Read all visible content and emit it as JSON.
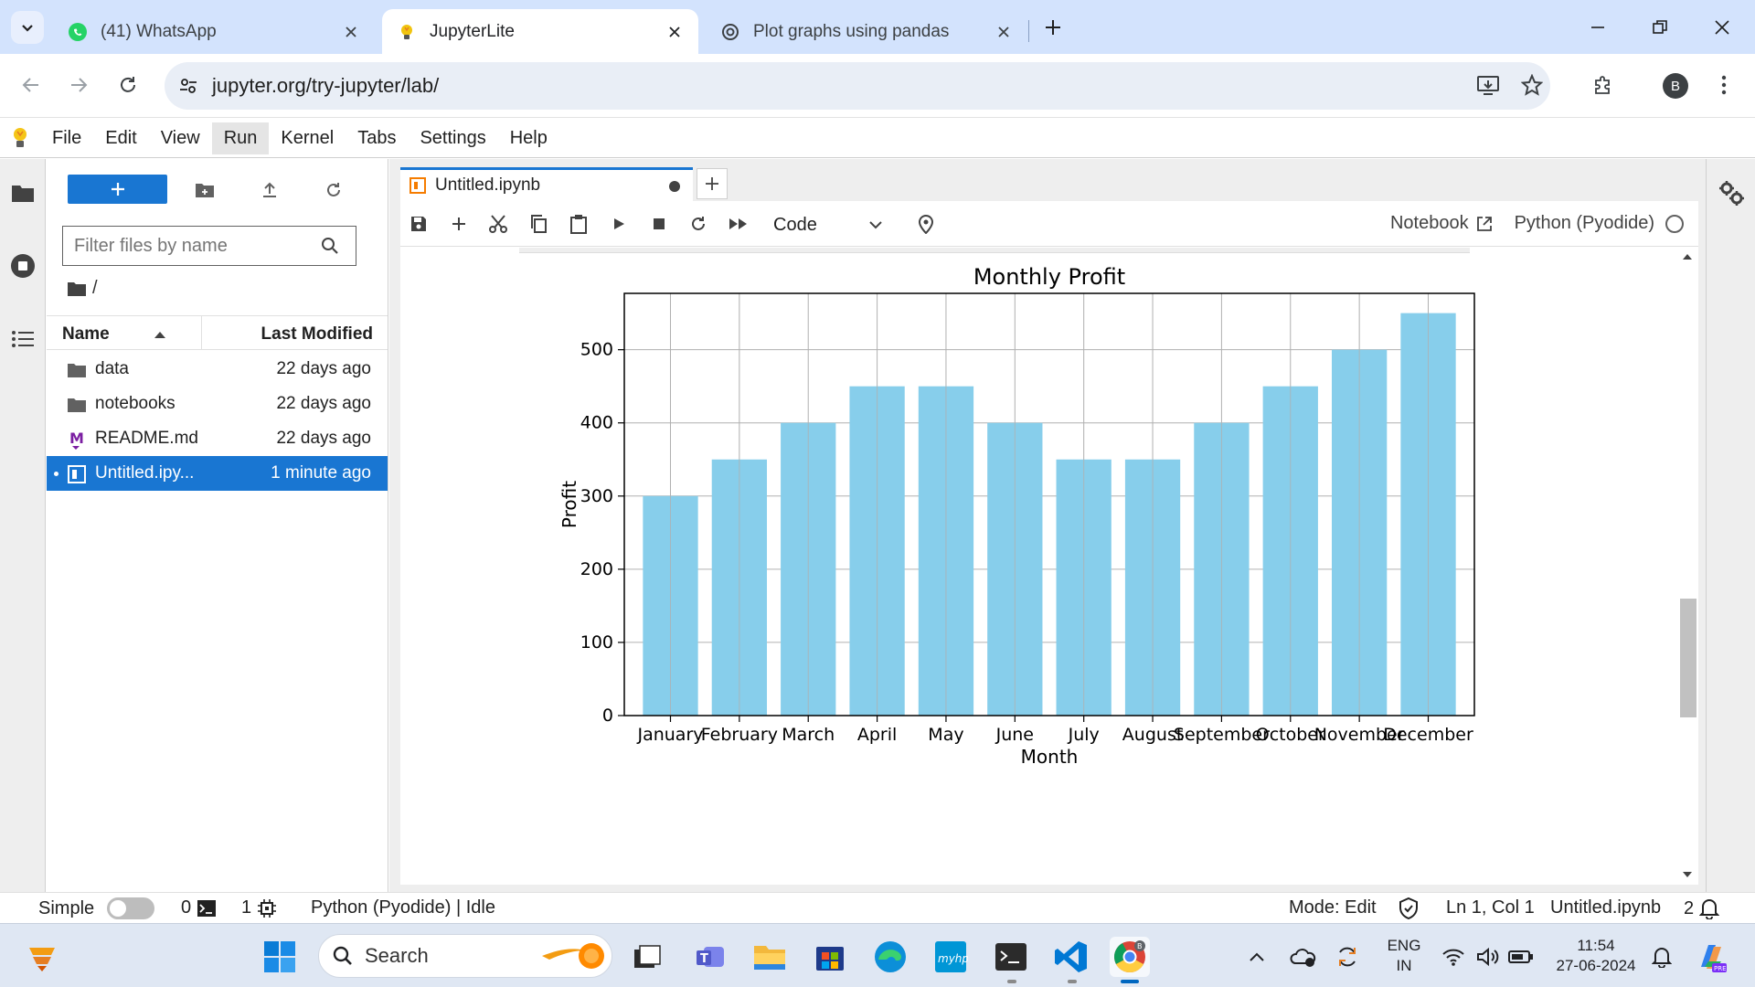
{
  "browser": {
    "tabs": [
      {
        "title": "(41) WhatsApp",
        "icon": "whatsapp-icon"
      },
      {
        "title": "JupyterLite",
        "icon": "jupyter-icon",
        "active": true
      },
      {
        "title": "Plot graphs using pandas",
        "icon": "openai-icon"
      }
    ],
    "url": "jupyter.org/try-jupyter/lab/",
    "profile_initial": "B"
  },
  "menubar": {
    "items": [
      "File",
      "Edit",
      "View",
      "Run",
      "Kernel",
      "Tabs",
      "Settings",
      "Help"
    ],
    "active": "Run"
  },
  "filebrowser": {
    "filter_placeholder": "Filter files by name",
    "breadcrumb": "/",
    "columns": {
      "name": "Name",
      "modified": "Last Modified"
    },
    "files": [
      {
        "name": "data",
        "modified": "22 days ago",
        "type": "folder"
      },
      {
        "name": "notebooks",
        "modified": "22 days ago",
        "type": "folder"
      },
      {
        "name": "README.md",
        "modified": "22 days ago",
        "type": "markdown"
      },
      {
        "name": "Untitled.ipy...",
        "modified": "1 minute ago",
        "type": "notebook",
        "selected": true
      }
    ]
  },
  "notebook": {
    "tab_title": "Untitled.ipynb",
    "cell_type": "Code",
    "notebook_label": "Notebook",
    "kernel_name": "Python (Pyodide)"
  },
  "chart_data": {
    "type": "bar",
    "title": "Monthly Profit",
    "xlabel": "Month",
    "ylabel": "Profit",
    "categories": [
      "January",
      "February",
      "March",
      "April",
      "May",
      "June",
      "July",
      "August",
      "September",
      "October",
      "November",
      "December"
    ],
    "values": [
      300,
      350,
      400,
      450,
      450,
      400,
      350,
      350,
      400,
      450,
      500,
      550
    ],
    "ylim": [
      0,
      577
    ],
    "yticks": [
      0,
      100,
      200,
      300,
      400,
      500
    ],
    "grid": true,
    "bar_color": "#87ceeb"
  },
  "statusbar": {
    "mode_label": "Simple",
    "terminals_count": "0",
    "kernels_count": "1",
    "kernel_status": "Python (Pyodide) | Idle",
    "edit_mode": "Mode: Edit",
    "cursor": "Ln 1, Col 1",
    "filename": "Untitled.ipynb",
    "notifications": "2"
  },
  "taskbar": {
    "search_label": "Search",
    "lang_top": "ENG",
    "lang_bottom": "IN",
    "time": "11:54",
    "date": "27-06-2024"
  },
  "colors": {
    "accent": "#1976d2",
    "tabstrip": "#d3e3fd",
    "bar": "#87ceeb"
  }
}
